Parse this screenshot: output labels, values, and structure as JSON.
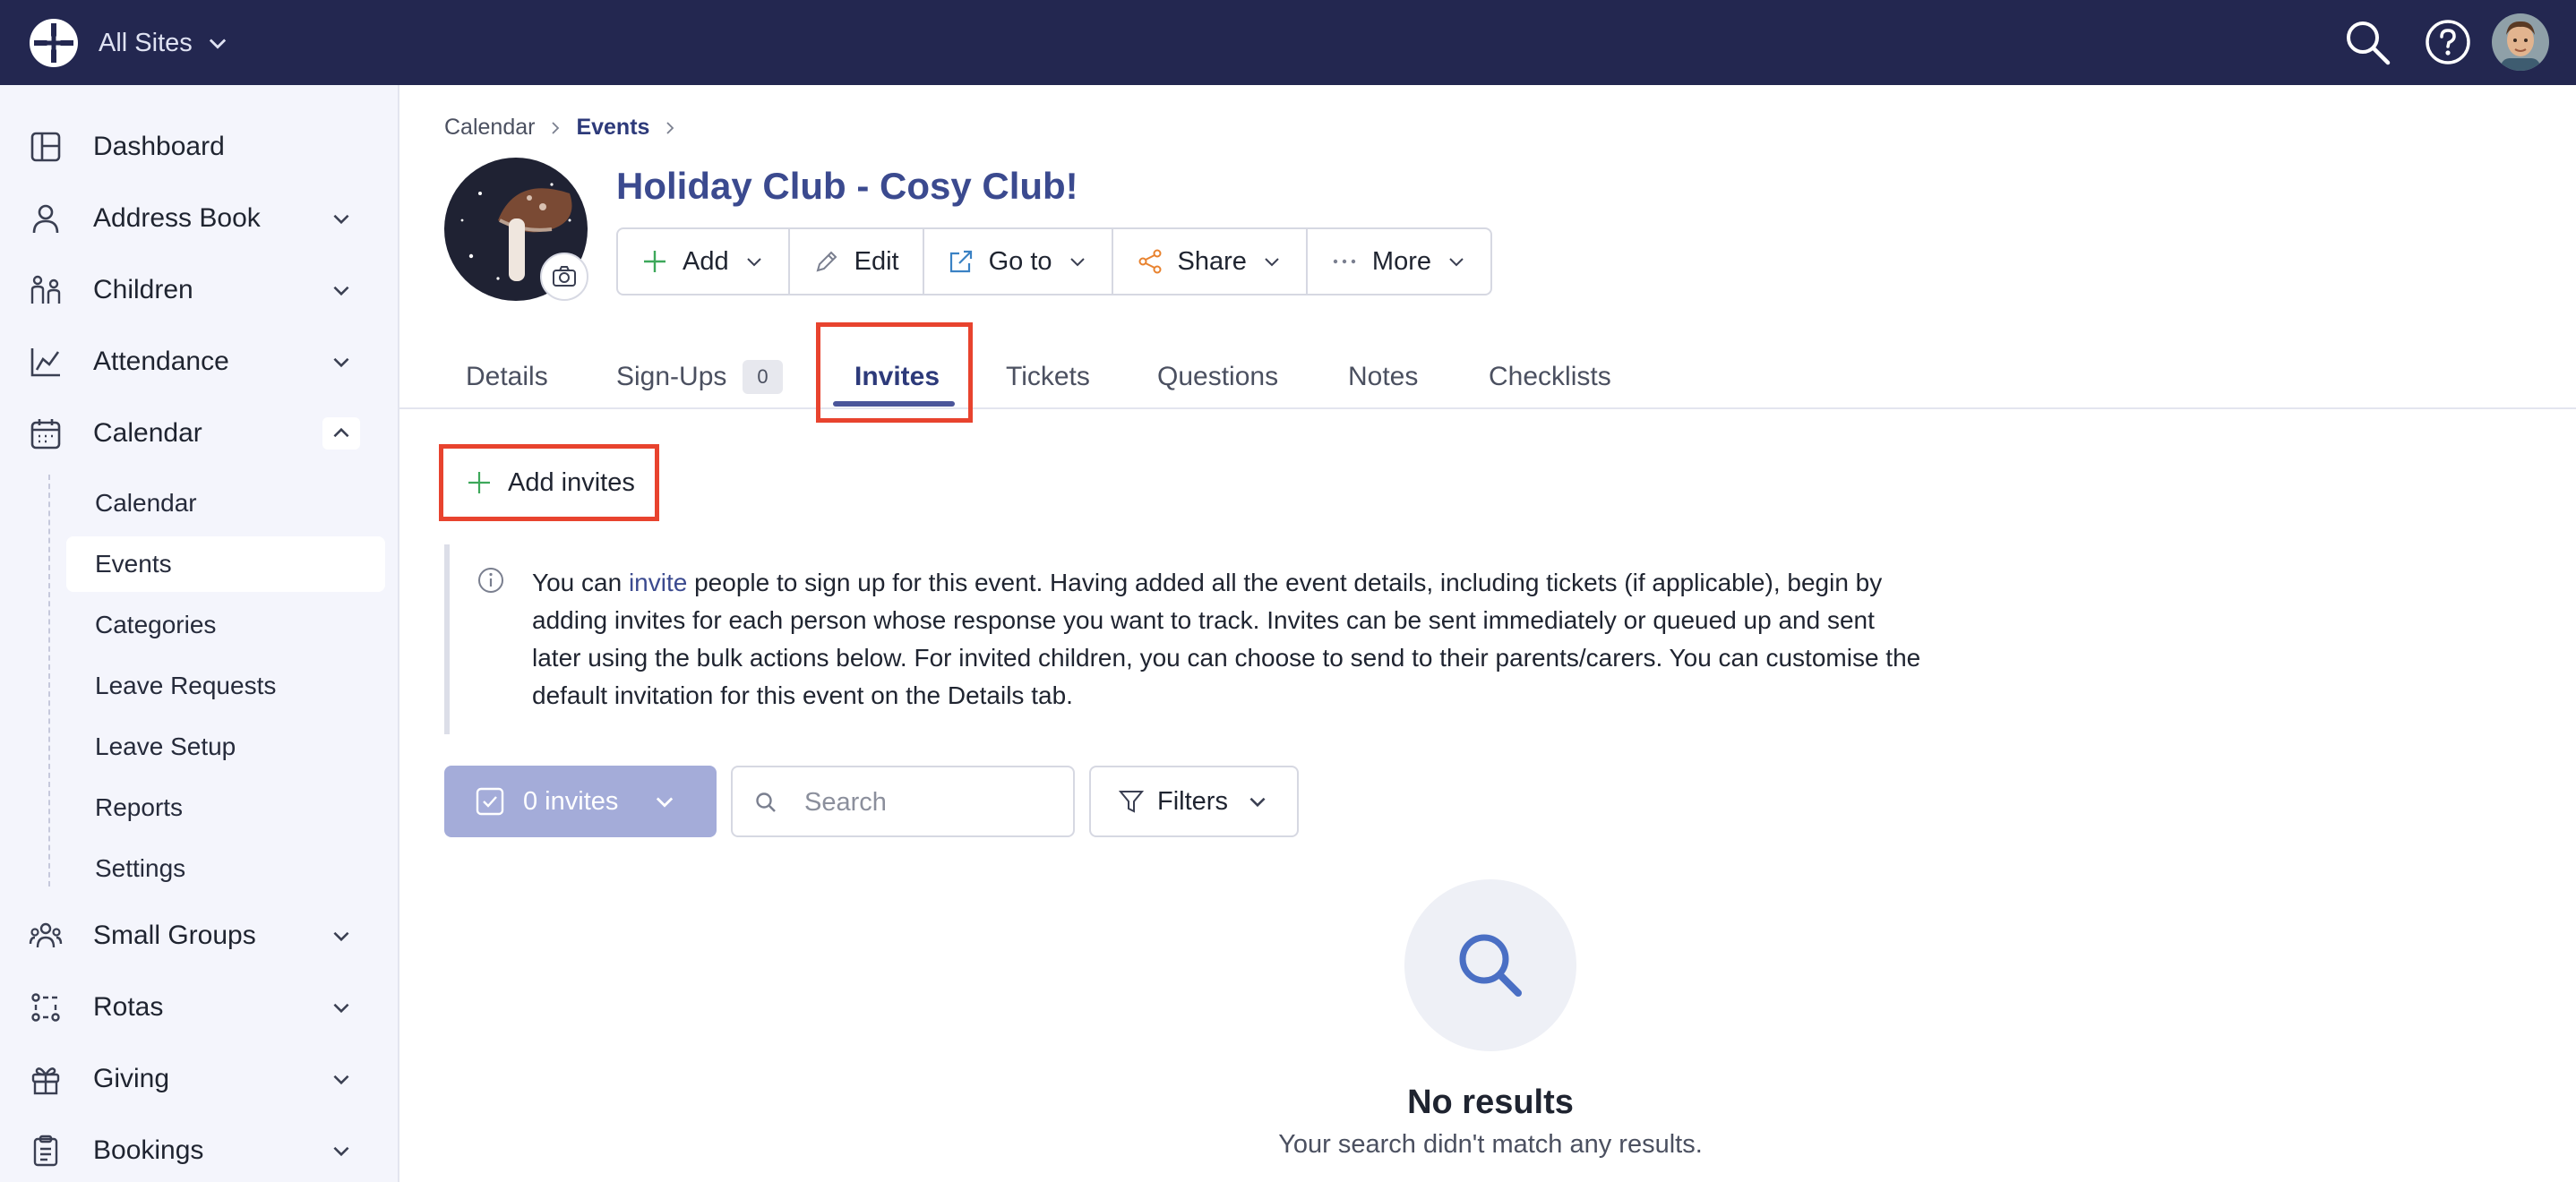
{
  "topbar": {
    "site_switch_label": "All Sites",
    "icons": [
      "logo-icon",
      "search-icon",
      "help-icon",
      "user-avatar"
    ]
  },
  "sidebar": {
    "items": [
      {
        "label": "Dashboard",
        "icon": "dashboard-icon",
        "has_chevron": false
      },
      {
        "label": "Address Book",
        "icon": "person-icon",
        "has_chevron": true
      },
      {
        "label": "Children",
        "icon": "children-icon",
        "has_chevron": true
      },
      {
        "label": "Attendance",
        "icon": "chart-icon",
        "has_chevron": true
      },
      {
        "label": "Calendar",
        "icon": "calendar-icon",
        "has_chevron": true,
        "expanded": true
      },
      {
        "label": "Small Groups",
        "icon": "group-icon",
        "has_chevron": true
      },
      {
        "label": "Rotas",
        "icon": "rotas-icon",
        "has_chevron": true
      },
      {
        "label": "Giving",
        "icon": "gift-icon",
        "has_chevron": true
      },
      {
        "label": "Bookings",
        "icon": "clipboard-icon",
        "has_chevron": true
      }
    ],
    "calendar_sub_items": [
      {
        "label": "Calendar"
      },
      {
        "label": "Events",
        "active": true
      },
      {
        "label": "Categories"
      },
      {
        "label": "Leave Requests"
      },
      {
        "label": "Leave Setup"
      },
      {
        "label": "Reports"
      },
      {
        "label": "Settings"
      }
    ]
  },
  "breadcrumb": {
    "items": [
      "Calendar",
      "Events"
    ]
  },
  "event": {
    "title": "Holiday Club - Cosy Club!"
  },
  "actions": [
    {
      "label": "Add",
      "icon": "plus-icon"
    },
    {
      "label": "Edit",
      "icon": "pencil-icon"
    },
    {
      "label": "Go to",
      "icon": "external-link-icon"
    },
    {
      "label": "Share",
      "icon": "share-icon"
    },
    {
      "label": "More",
      "icon": "ellipsis-icon"
    }
  ],
  "tabs": [
    {
      "label": "Details"
    },
    {
      "label": "Sign-Ups",
      "count": "0"
    },
    {
      "label": "Invites",
      "active": true
    },
    {
      "label": "Tickets"
    },
    {
      "label": "Questions"
    },
    {
      "label": "Notes"
    },
    {
      "label": "Checklists"
    }
  ],
  "invites": {
    "add_button_label": "Add invites",
    "info_pre": "You can ",
    "info_link": "invite",
    "info_post": " people to sign up for this event. Having added all the event details, including tickets (if applicable), begin by adding invites for each person whose response you want to track. Invites can be sent immediately or queued up and sent later using the bulk actions below. For invited children, you can choose to send to their parents/carers. You can customise the default invitation for this event on the Details tab.",
    "bulk_label": "0 invites",
    "search_placeholder": "Search",
    "filters_label": "Filters",
    "empty_title": "No results",
    "empty_subtitle": "Your search didn't match any results."
  },
  "colors": {
    "topbar": "#232750",
    "accent": "#3b4a8f",
    "highlight": "#e8432e",
    "bulk_button": "#a4acd9"
  }
}
